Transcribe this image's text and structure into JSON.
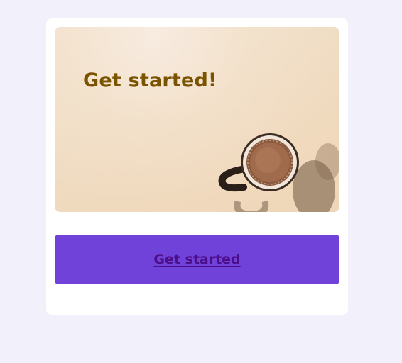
{
  "hero": {
    "title": "Get started!",
    "image": "coffee-mug-photo"
  },
  "cta": {
    "label": "Get started"
  },
  "colors": {
    "page_background": "#f1f0fb",
    "card_background": "#ffffff",
    "hero_title": "#7a5300",
    "cta_background": "#7142d9",
    "cta_text": "#4d0e8a"
  }
}
